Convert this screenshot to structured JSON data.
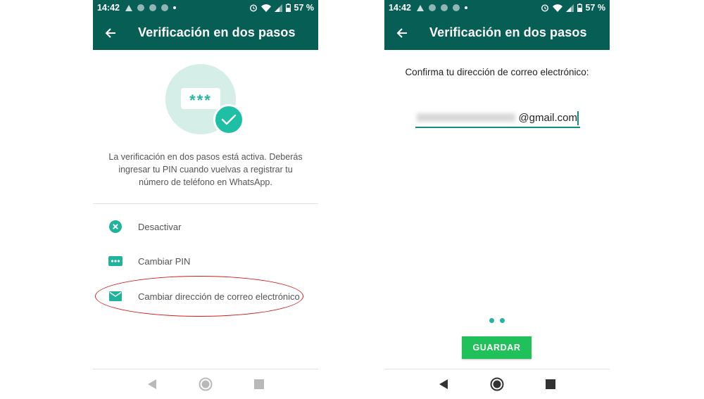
{
  "colors": {
    "toolbar": "#075e54",
    "accent": "#25b8a0",
    "button": "#20c15a",
    "highlight": "#d01e1e"
  },
  "left_screen": {
    "status": {
      "time": "14:42",
      "battery": "57 %"
    },
    "appbar": {
      "title": "Verificación en dos pasos",
      "back_icon": "arrow-left-icon"
    },
    "hero": {
      "pin_mask": "***",
      "badge_icon": "check-icon"
    },
    "description": "La verificación en dos pasos está activa. Deberás ingresar tu PIN cuando vuelvas a registrar tu número de teléfono en WhatsApp.",
    "options": [
      {
        "label": "Desactivar",
        "icon": "x-circle-icon"
      },
      {
        "label": "Cambiar PIN",
        "icon": "pin-dots-icon"
      },
      {
        "label": "Cambiar dirección de correo electrónico",
        "icon": "envelope-icon"
      }
    ]
  },
  "right_screen": {
    "status": {
      "time": "14:42",
      "battery": "57 %"
    },
    "appbar": {
      "title": "Verificación en dos pasos",
      "back_icon": "arrow-left-icon"
    },
    "prompt": "Confirma tu dirección de correo electrónico:",
    "email": {
      "value": "@gmail.com"
    },
    "page_indicator": {
      "count": 2
    },
    "save_label": "GUARDAR"
  },
  "nav": {
    "back_icon": "nav-back-icon",
    "home_icon": "nav-home-icon",
    "recents_icon": "nav-recents-icon"
  }
}
